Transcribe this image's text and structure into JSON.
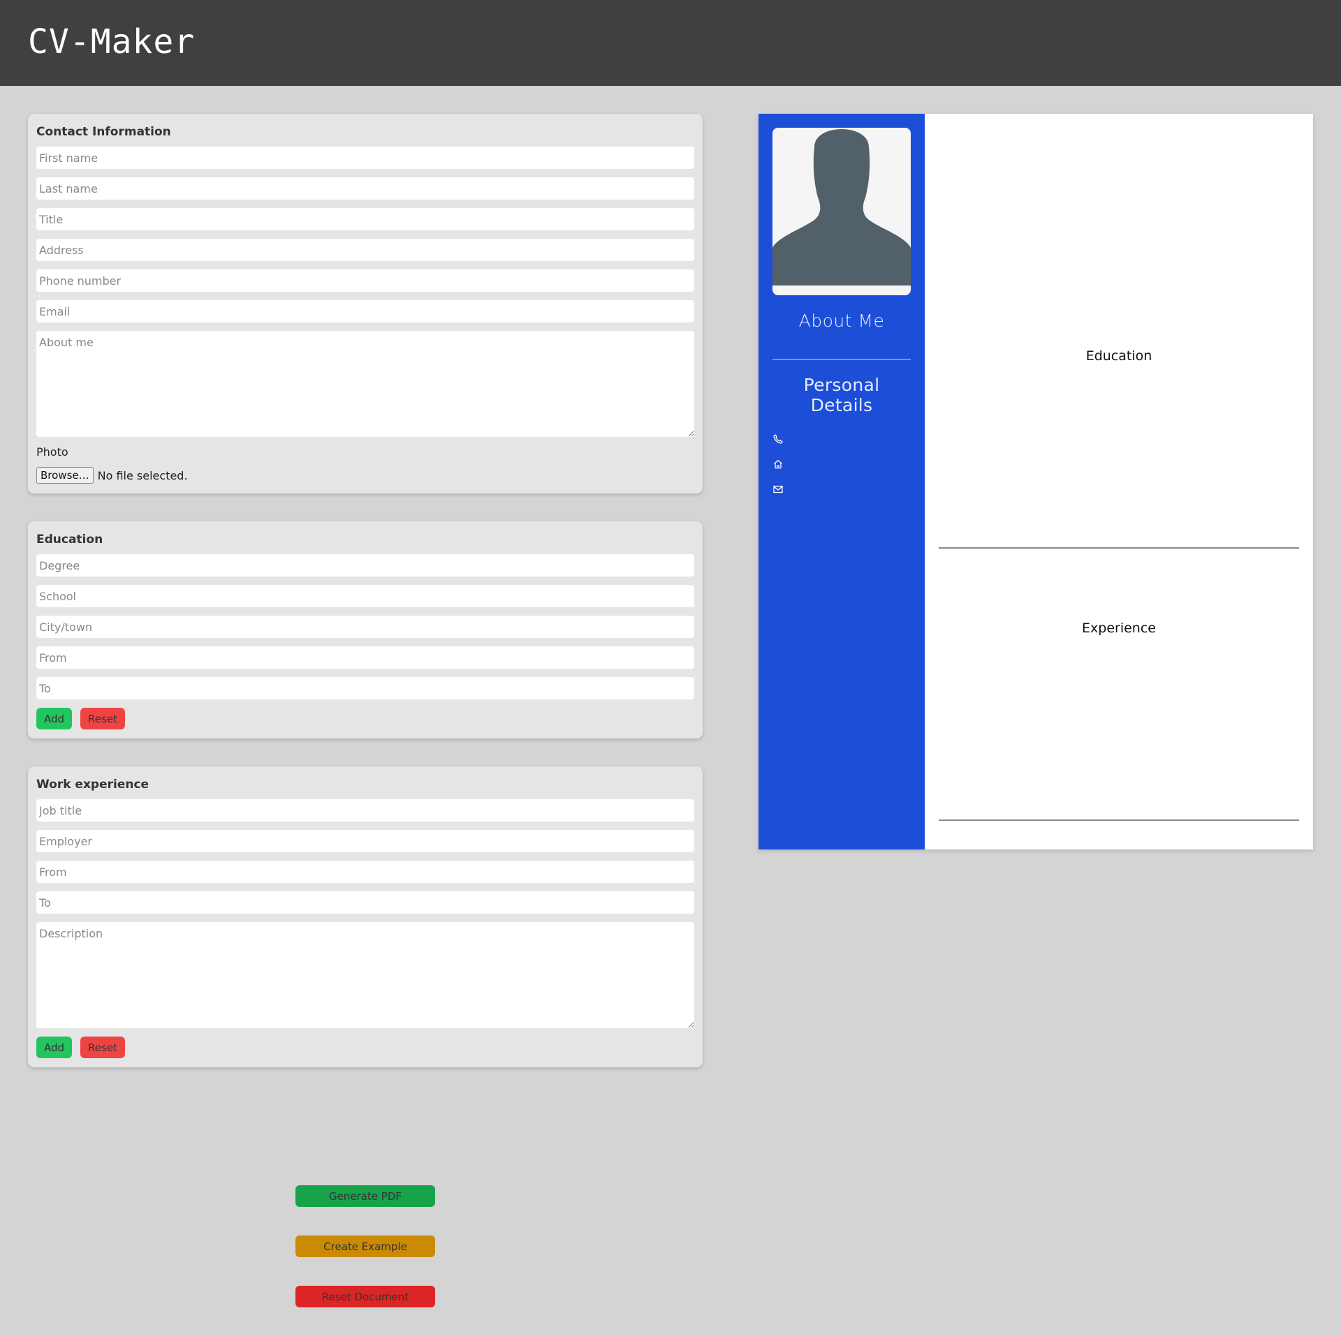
{
  "app": {
    "title": "CV-Maker"
  },
  "contact": {
    "heading": "Contact Information",
    "first_name_placeholder": "First name",
    "last_name_placeholder": "Last name",
    "title_placeholder": "Title",
    "address_placeholder": "Address",
    "phone_placeholder": "Phone number",
    "email_placeholder": "Email",
    "about_placeholder": "About me",
    "photo_label": "Photo",
    "browse_label": "Browse…",
    "no_file_text": "No file selected."
  },
  "education": {
    "heading": "Education",
    "degree_placeholder": "Degree",
    "school_placeholder": "School",
    "city_placeholder": "City/town",
    "from_placeholder": "From",
    "to_placeholder": "To",
    "add_label": "Add",
    "reset_label": "Reset"
  },
  "work": {
    "heading": "Work experience",
    "job_title_placeholder": "Job title",
    "employer_placeholder": "Employer",
    "from_placeholder": "From",
    "to_placeholder": "To",
    "description_placeholder": "Description",
    "add_label": "Add",
    "reset_label": "Reset"
  },
  "actions": {
    "generate_pdf": "Generate PDF",
    "create_example": "Create Example",
    "reset_document": "Reset Document"
  },
  "preview": {
    "about_heading": "About Me",
    "personal_details_heading": "Personal Details",
    "contact_icons": [
      "phone-icon",
      "home-icon",
      "mail-icon"
    ],
    "education_title": "Education",
    "experience_title": "Experience"
  },
  "colors": {
    "header_bg": "#404040",
    "page_bg": "#d4d4d4",
    "sidebar_bg": "#1d4ed8",
    "add_button": "#22c55e",
    "reset_button": "#ef4444",
    "generate_pdf": "#16a34a",
    "create_example": "#ca8a04",
    "reset_document": "#dc2626"
  }
}
